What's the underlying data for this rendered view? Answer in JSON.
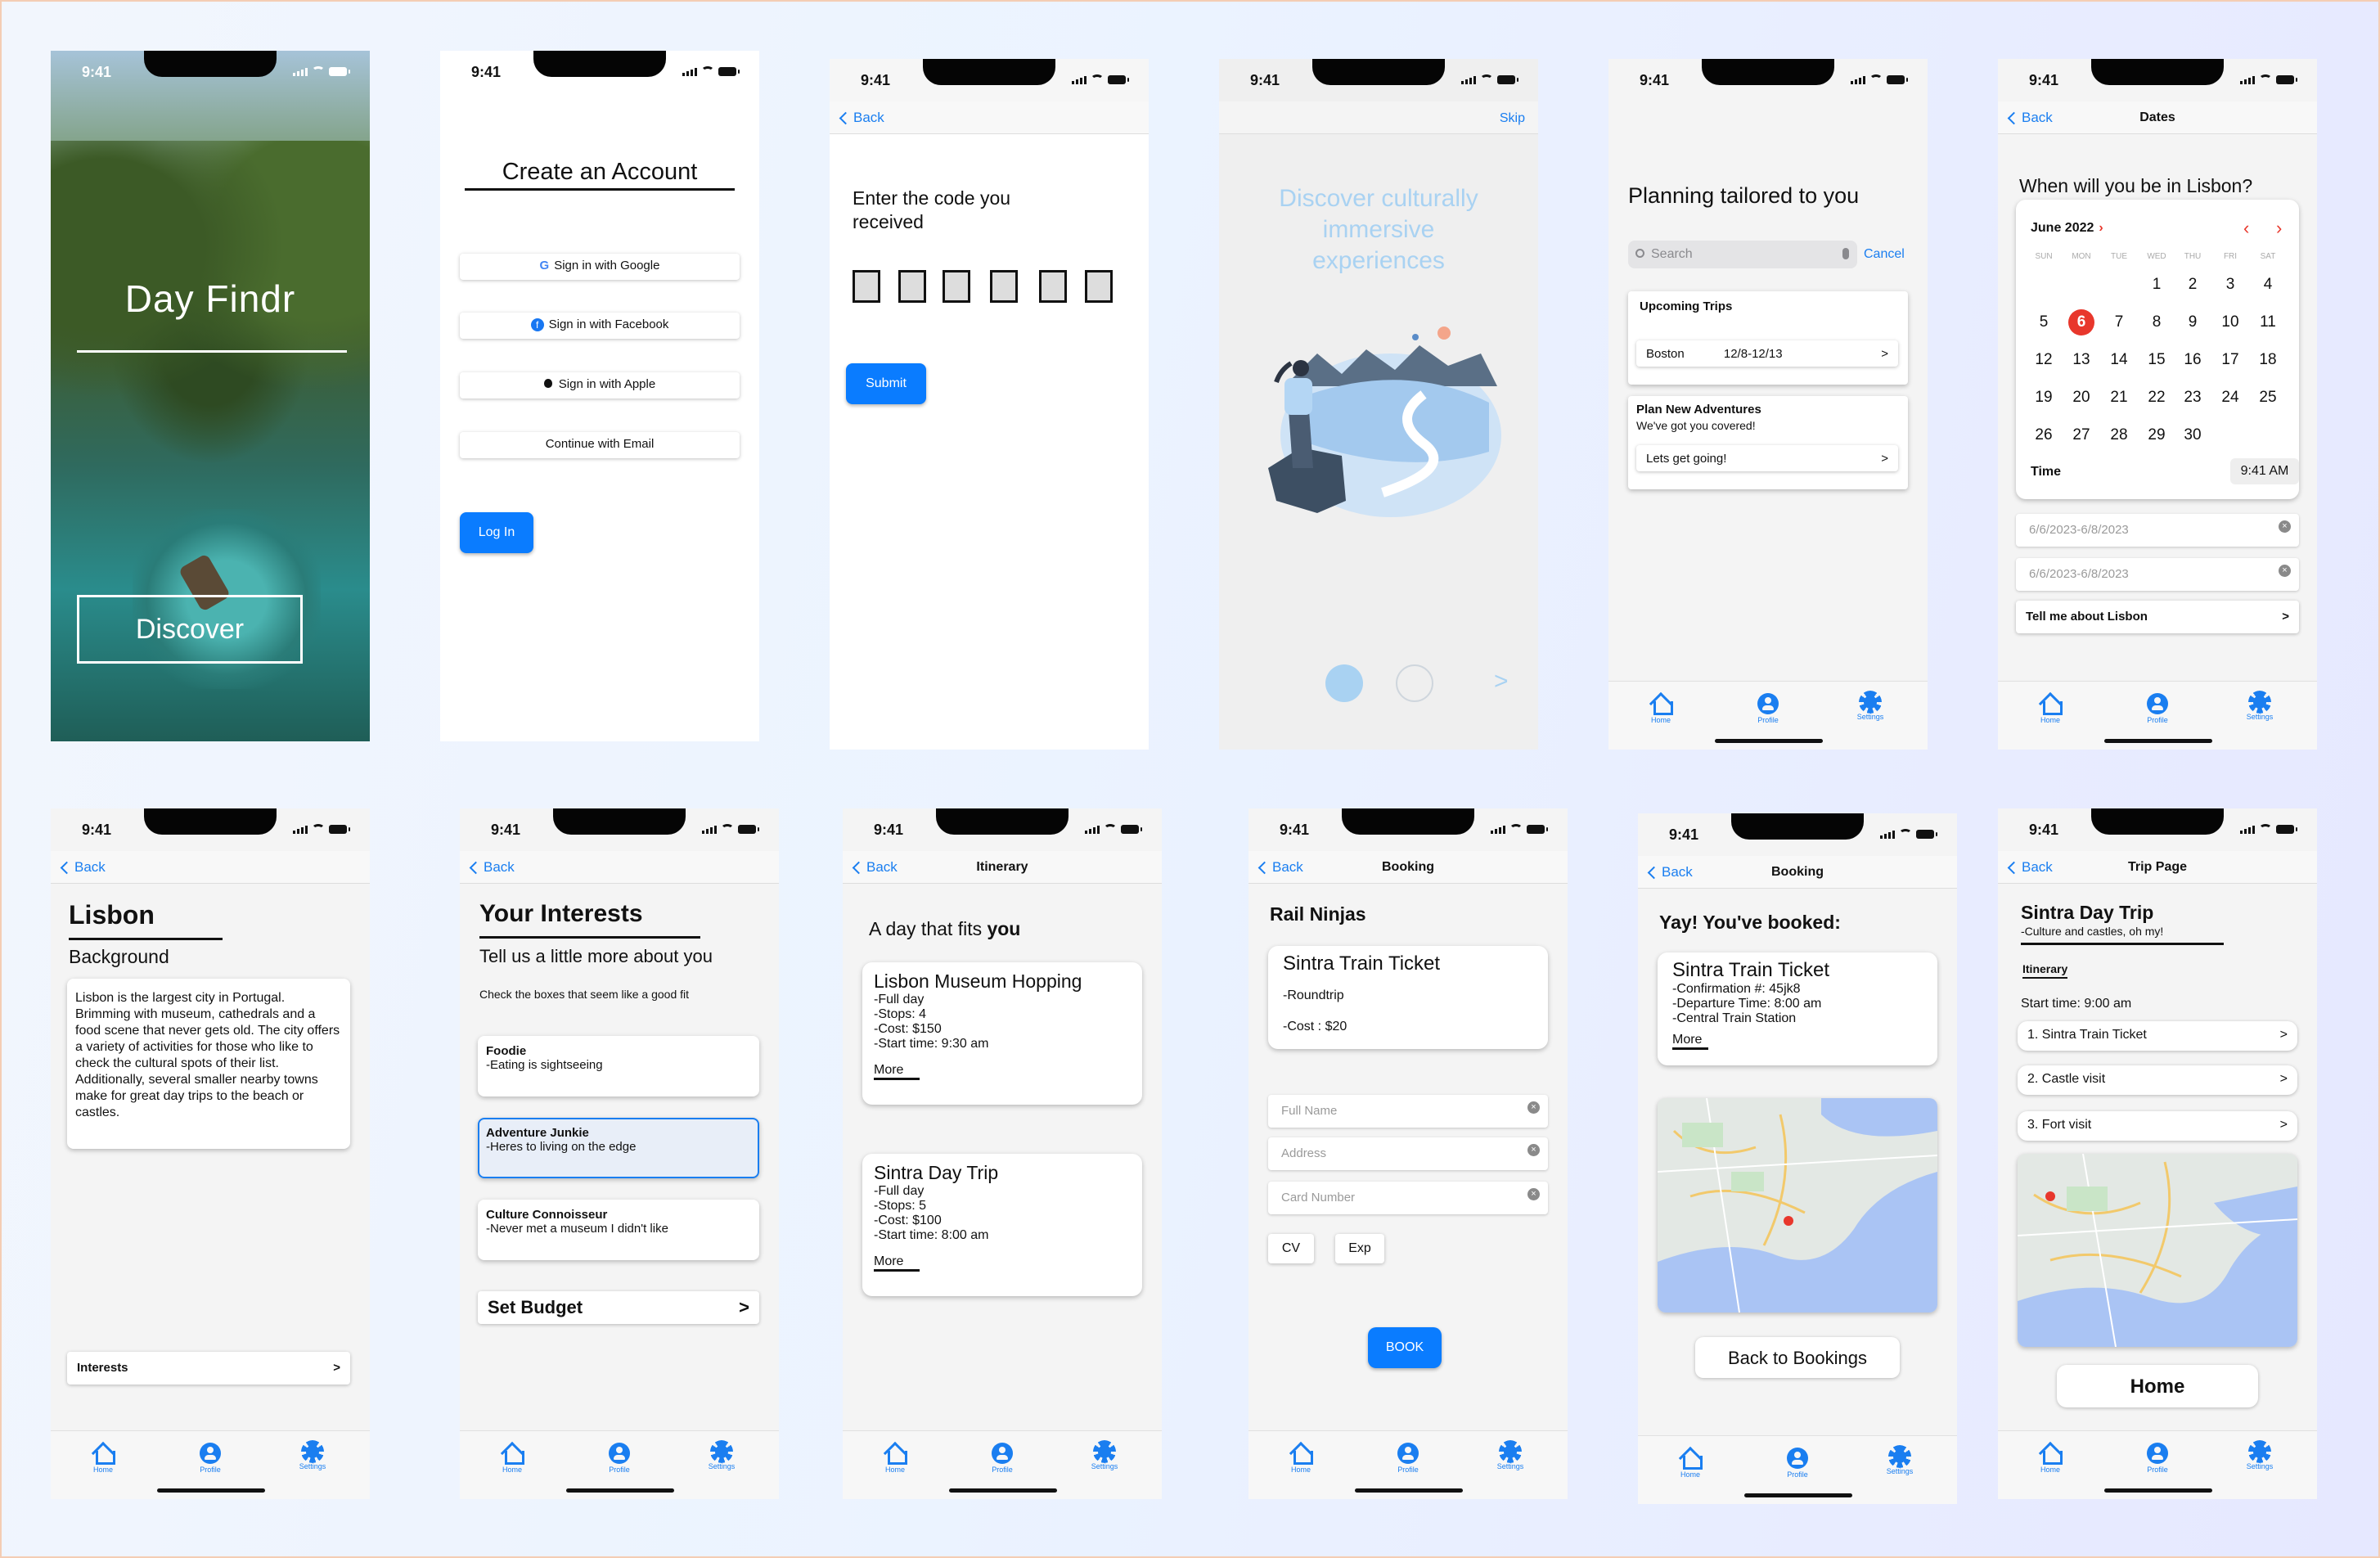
{
  "status_time": "9:41",
  "tabbar": {
    "home": "Home",
    "profile": "Profile",
    "settings": "Settings"
  },
  "back": "Back",
  "s1": {
    "app_name": "Day Findr",
    "discover": "Discover"
  },
  "s2": {
    "title": "Create an Account",
    "google": "Sign in with Google",
    "facebook": "Sign in with Facebook",
    "apple": "Sign in with Apple",
    "email": "Continue with Email",
    "login": "Log In"
  },
  "s3": {
    "heading": "Enter the code you received",
    "submit": "Submit"
  },
  "s4": {
    "skip": "Skip",
    "heading": "Discover culturally immersive experiences",
    "next": ">"
  },
  "s5": {
    "heading": "Planning tailored to you",
    "search_placeholder": "Search",
    "cancel": "Cancel",
    "upcoming": "Upcoming Trips",
    "trip_city": "Boston",
    "trip_dates": "12/8-12/13",
    "plan_title": "Plan New Adventures",
    "plan_sub": "We've got you covered!",
    "lets_go": "Lets get going!"
  },
  "s6": {
    "nav_title": "Dates",
    "heading": "When will you be in Lisbon?",
    "month": "June 2022",
    "weekdays": [
      "SUN",
      "MON",
      "TUE",
      "WED",
      "THU",
      "FRI",
      "SAT"
    ],
    "selected_day": "6",
    "time_label": "Time",
    "time_value": "9:41 AM",
    "range1": "6/6/2023-6/8/2023",
    "range2": "6/6/2023-6/8/2023",
    "tell": "Tell me about Lisbon"
  },
  "s7": {
    "title": "Lisbon",
    "subtitle": "Background",
    "body": "Lisbon is the largest city in Portugal. Brimming with museum, cathedrals and a food scene that never gets old. The city offers a variety of activities for those who like to check the cultural spots of their list. Additionally, several smaller nearby towns make for great day trips to the beach or castles.",
    "interests": "Interests"
  },
  "s8": {
    "title": "Your Interests",
    "subtitle": "Tell us a little more about you",
    "hint": "Check the boxes that seem like a good fit",
    "options": [
      {
        "name": "Foodie",
        "desc": "-Eating is sightseeing"
      },
      {
        "name": "Adventure Junkie",
        "desc": "-Heres to living on the edge"
      },
      {
        "name": "Culture Connoisseur",
        "desc": "-Never met a museum I didn't like"
      }
    ],
    "budget": "Set Budget"
  },
  "s9": {
    "nav_title": "Itinerary",
    "heading_a": "A day that fits ",
    "heading_b": "you",
    "cards": [
      {
        "title": "Lisbon Museum Hopping",
        "lines": [
          "-Full day",
          "-Stops: 4",
          "-Cost: $150",
          "-Start time: 9:30 am"
        ],
        "more": "More"
      },
      {
        "title": "Sintra Day Trip",
        "lines": [
          "-Full day",
          "-Stops: 5",
          "-Cost: $100",
          "-Start time: 8:00 am"
        ],
        "more": "More"
      }
    ]
  },
  "s10": {
    "nav_title": "Booking",
    "company": "Rail Ninjas",
    "ticket": "Sintra Train Ticket",
    "type": "-Roundtrip",
    "cost": "-Cost : $20",
    "full_name": "Full Name",
    "address": "Address",
    "card": "Card Number",
    "cv": "CV",
    "exp": "Exp",
    "book": "BOOK"
  },
  "s11": {
    "nav_title": "Booking",
    "heading": "Yay! You've booked:",
    "ticket": "Sintra Train Ticket",
    "lines": [
      "-Confirmation #: 45jk8",
      "-Departure Time: 8:00 am",
      "-Central Train Station"
    ],
    "more": "More",
    "back_btn": "Back to Bookings"
  },
  "s12": {
    "nav_title": "Trip Page",
    "title": "Sintra Day Trip",
    "subtitle": "-Culture and castles, oh my!",
    "itinerary_tab": "Itinerary",
    "start": "Start time: 9:00 am",
    "stops": [
      "1. Sintra Train Ticket",
      "2. Castle visit",
      "3. Fort visit"
    ],
    "home_btn": "Home"
  },
  "colors": {
    "accent": "#0a7cff",
    "heading_blue": "#a9d2f2",
    "red": "#e8372c"
  }
}
